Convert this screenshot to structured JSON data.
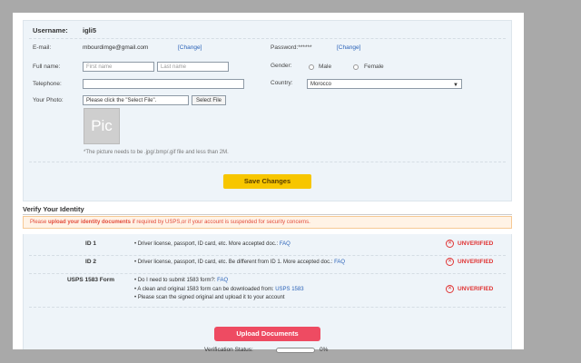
{
  "profile": {
    "username_label": "Username:",
    "username": "igli5",
    "email_label": "E-mail:",
    "email": "mbourdimge@gmail.com",
    "email_change": "[Change]",
    "password_label": "Password:",
    "password_mask": "******",
    "password_change": "[Change]",
    "fullname_label": "Full name:",
    "first_name_placeholder": "First name",
    "last_name_placeholder": "Last name",
    "gender_label": "Gender:",
    "gender_male": "Male",
    "gender_female": "Female",
    "telephone_label": "Telephone:",
    "telephone_value": "",
    "country_label": "Country:",
    "country_value": "Morocco",
    "photo_label": "Your Photo:",
    "photo_field_text": "Please click the \"Select File\".",
    "select_file_label": "Select File",
    "pic_placeholder": "Pic",
    "photo_hint": "*The picture needs to be .jpg/.bmp/.gif file and less than 2M.",
    "save_label": "Save Changes"
  },
  "verify": {
    "title": "Verify Your Identity",
    "warning_prefix": "Please ",
    "warning_bold": "upload your identity documents",
    "warning_suffix": " if required by USPS,or if your account is suspended for security concerns.",
    "rows": [
      {
        "name": "ID 1",
        "lines": [
          "• Driver license, passport, ID card, etc. More accepted doc.: "
        ],
        "link": "FAQ",
        "status": "UNVERIFIED"
      },
      {
        "name": "ID 2",
        "lines": [
          "• Driver license, passport, ID card, etc. Be different from ID 1. More accepted doc.: "
        ],
        "link": "FAQ",
        "status": "UNVERIFIED"
      },
      {
        "name": "USPS 1583 Form",
        "lines": [
          "• Do I need to submit 1583 form?: ",
          "• A clean and original 1583 form can be downloaded from: ",
          "• Please scan the signed original and upload it to your account"
        ],
        "links": [
          "FAQ",
          "USPS 1583"
        ],
        "status": "UNVERIFIED"
      }
    ],
    "upload_label": "Upload Documents",
    "status_label": "Verification Status:",
    "progress_percent": 0,
    "progress_text": "0%",
    "status_icon": "x-circle-icon"
  },
  "colors": {
    "accent_link": "#2a62b8",
    "save_button": "#f7c600",
    "upload_button": "#ee4b62",
    "unverified": "#e03535"
  }
}
